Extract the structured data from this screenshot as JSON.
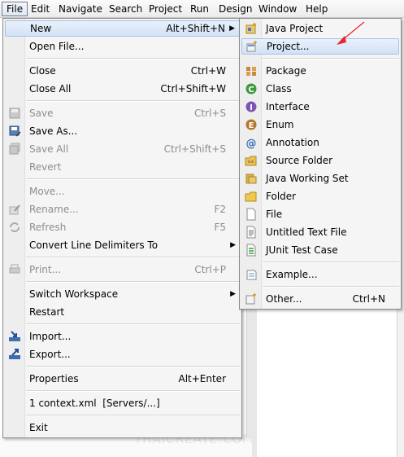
{
  "menubar": {
    "items": [
      "File",
      "Edit",
      "Navigate",
      "Search",
      "Project",
      "Run",
      "Design",
      "Window",
      "Help"
    ]
  },
  "file_menu": {
    "new": {
      "label": "New",
      "acc": "Alt+Shift+N"
    },
    "open_file": {
      "label": "Open File..."
    },
    "close": {
      "label": "Close",
      "acc": "Ctrl+W"
    },
    "close_all": {
      "label": "Close All",
      "acc": "Ctrl+Shift+W"
    },
    "save": {
      "label": "Save",
      "acc": "Ctrl+S"
    },
    "save_as": {
      "label": "Save As..."
    },
    "save_all": {
      "label": "Save All",
      "acc": "Ctrl+Shift+S"
    },
    "revert": {
      "label": "Revert"
    },
    "move": {
      "label": "Move..."
    },
    "rename": {
      "label": "Rename...",
      "acc": "F2"
    },
    "refresh": {
      "label": "Refresh",
      "acc": "F5"
    },
    "convert": {
      "label": "Convert Line Delimiters To"
    },
    "print": {
      "label": "Print...",
      "acc": "Ctrl+P"
    },
    "switch_workspace": {
      "label": "Switch Workspace"
    },
    "restart": {
      "label": "Restart"
    },
    "import": {
      "label": "Import..."
    },
    "export": {
      "label": "Export..."
    },
    "properties": {
      "label": "Properties",
      "acc": "Alt+Enter"
    },
    "recent": {
      "label": "1 context.xml  [Servers/...]"
    },
    "exit": {
      "label": "Exit"
    }
  },
  "new_menu": {
    "java_project": "Java Project",
    "project": "Project...",
    "package": "Package",
    "class": "Class",
    "interface": "Interface",
    "enum": "Enum",
    "annotation": "Annotation",
    "source_folder": "Source Folder",
    "java_working_set": "Java Working Set",
    "folder": "Folder",
    "file": "File",
    "untitled_text_file": "Untitled Text File",
    "junit_test_case": "JUnit Test Case",
    "example": "Example...",
    "other": {
      "label": "Other...",
      "acc": "Ctrl+N"
    }
  },
  "watermark": "THAICREATE.COM",
  "colors": {
    "accent_arrow": "#e8262a",
    "highlight": "#d2e2f6"
  }
}
